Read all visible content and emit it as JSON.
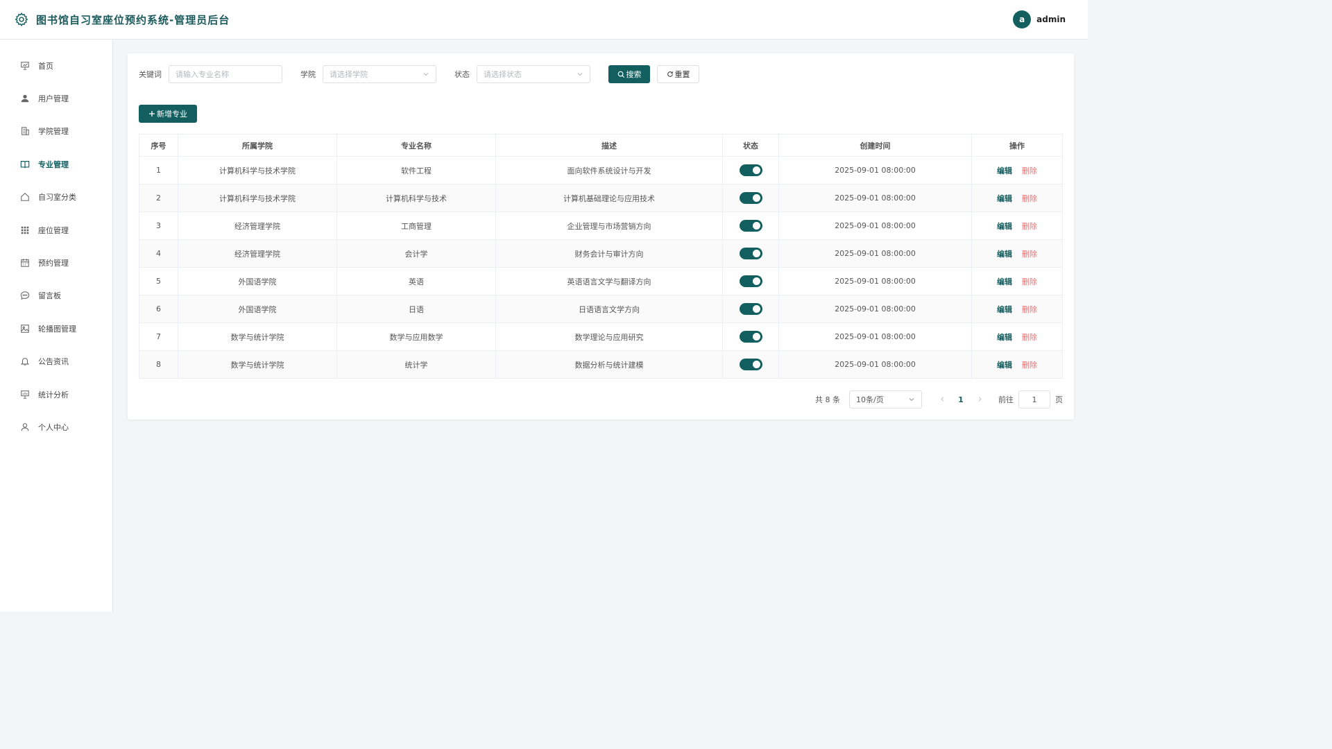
{
  "header": {
    "title": "图书馆自习室座位预约系统-管理员后台",
    "avatar_letter": "a",
    "username": "admin"
  },
  "sidebar": {
    "items": [
      {
        "label": "首页",
        "icon": "presentation-chart-icon"
      },
      {
        "label": "用户管理",
        "icon": "user-icon"
      },
      {
        "label": "学院管理",
        "icon": "building-icon"
      },
      {
        "label": "专业管理",
        "icon": "book-icon",
        "active": true
      },
      {
        "label": "自习室分类",
        "icon": "home-icon"
      },
      {
        "label": "座位管理",
        "icon": "grid-icon"
      },
      {
        "label": "预约管理",
        "icon": "calendar-icon"
      },
      {
        "label": "留言板",
        "icon": "chat-icon"
      },
      {
        "label": "轮播图管理",
        "icon": "image-icon"
      },
      {
        "label": "公告资讯",
        "icon": "bell-icon"
      },
      {
        "label": "统计分析",
        "icon": "chart-icon"
      },
      {
        "label": "个人中心",
        "icon": "person-icon"
      }
    ]
  },
  "filters": {
    "keyword_label": "关键词",
    "keyword_placeholder": "请输入专业名称",
    "college_label": "学院",
    "college_placeholder": "请选择学院",
    "status_label": "状态",
    "status_placeholder": "请选择状态",
    "search_label": "搜索",
    "reset_label": "重置"
  },
  "add_button_label": "新增专业",
  "table": {
    "headers": [
      "序号",
      "所属学院",
      "专业名称",
      "描述",
      "状态",
      "创建时间",
      "操作"
    ],
    "rows": [
      {
        "no": "1",
        "college": "计算机科学与技术学院",
        "name": "软件工程",
        "desc": "面向软件系统设计与开发",
        "time": "2025-09-01 08:00:00"
      },
      {
        "no": "2",
        "college": "计算机科学与技术学院",
        "name": "计算机科学与技术",
        "desc": "计算机基础理论与应用技术",
        "time": "2025-09-01 08:00:00"
      },
      {
        "no": "3",
        "college": "经济管理学院",
        "name": "工商管理",
        "desc": "企业管理与市场营销方向",
        "time": "2025-09-01 08:00:00"
      },
      {
        "no": "4",
        "college": "经济管理学院",
        "name": "会计学",
        "desc": "财务会计与审计方向",
        "time": "2025-09-01 08:00:00"
      },
      {
        "no": "5",
        "college": "外国语学院",
        "name": "英语",
        "desc": "英语语言文学与翻译方向",
        "time": "2025-09-01 08:00:00"
      },
      {
        "no": "6",
        "college": "外国语学院",
        "name": "日语",
        "desc": "日语语言文学方向",
        "time": "2025-09-01 08:00:00"
      },
      {
        "no": "7",
        "college": "数学与统计学院",
        "name": "数学与应用数学",
        "desc": "数学理论与应用研究",
        "time": "2025-09-01 08:00:00"
      },
      {
        "no": "8",
        "college": "数学与统计学院",
        "name": "统计学",
        "desc": "数据分析与统计建模",
        "time": "2025-09-01 08:00:00"
      }
    ],
    "edit_label": "编辑",
    "delete_label": "删除"
  },
  "pagination": {
    "total_text": "共 8 条",
    "page_size": "10条/页",
    "current_page": "1",
    "goto_label": "前往",
    "goto_value": "1",
    "page_suffix": "页"
  },
  "colors": {
    "primary": "#135f5f",
    "danger": "#f56c6c"
  }
}
